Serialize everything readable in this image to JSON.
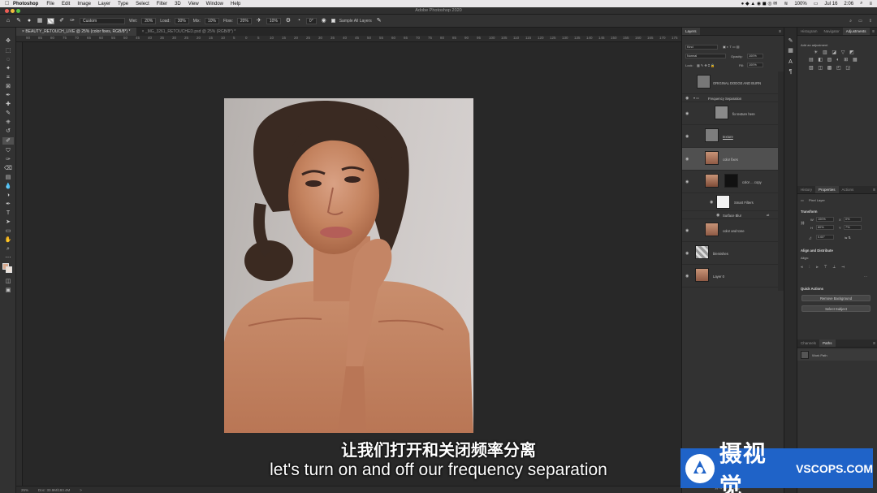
{
  "menubar": {
    "app_name": "Photoshop",
    "items": [
      "File",
      "Edit",
      "Image",
      "Layer",
      "Type",
      "Select",
      "Filter",
      "3D",
      "View",
      "Window",
      "Help"
    ],
    "battery": "100%",
    "date": "Jul 16",
    "time": "2:06"
  },
  "window": {
    "title": "Adobe Photoshop 2020"
  },
  "options": {
    "mode": "Custom",
    "size_label": "Wet:",
    "size_value": "20%",
    "load_label": "Load:",
    "load_value": "30%",
    "mix_label": "Mix:",
    "mix_value": "10%",
    "flow_label": "Flow:",
    "flow_value": "20%",
    "smoothing_value": "10%",
    "angle_value": "0°",
    "sample_all_layers": "Sample All Layers"
  },
  "document_tabs": [
    {
      "label": "BEAUTY_RETOUCH_LIVE @ 25% (color fixes, RGB/8*) *",
      "active": true
    },
    {
      "label": "_MG_3261_RETOUCHED.psd @ 25% (RGB/8*) *",
      "active": false
    }
  ],
  "ruler_ticks": [
    "90",
    "85",
    "80",
    "75",
    "70",
    "65",
    "60",
    "55",
    "50",
    "45",
    "40",
    "35",
    "30",
    "25",
    "20",
    "15",
    "10",
    "5",
    "0",
    "5",
    "10",
    "15",
    "20",
    "25",
    "30",
    "35",
    "40",
    "45",
    "50",
    "55",
    "60",
    "65",
    "70",
    "75",
    "80",
    "85",
    "90",
    "95",
    "100",
    "105",
    "110",
    "115",
    "120",
    "125",
    "130",
    "135",
    "140",
    "145",
    "150",
    "155",
    "160",
    "165",
    "170",
    "175"
  ],
  "status": {
    "zoom": "25%",
    "doc": "Doc: 33.9M/193.4M",
    "arrow": ">"
  },
  "subtitles": {
    "chinese": "让我们打开和关闭频率分离",
    "english": "let's turn on and off our frequency separation"
  },
  "layers_panel": {
    "tabs": [
      "Layers"
    ],
    "filter_kind": "Kind",
    "blend_mode": "Normal",
    "opacity_label": "Opacity:",
    "opacity_value": "100%",
    "lock_label": "Lock:",
    "fill_label": "Fill:",
    "fill_value": "100%",
    "layers": [
      {
        "name": "ORIGINAL DODGE AND BURN",
        "visible": false,
        "selected": false
      },
      {
        "name": "Frequency Separation",
        "visible": true,
        "selected": false,
        "group": true
      },
      {
        "name": "fix texture here",
        "visible": true,
        "selected": false
      },
      {
        "name": "texture",
        "visible": true,
        "selected": false
      },
      {
        "name": "color fixes",
        "visible": true,
        "selected": true
      },
      {
        "name": "color ... copy",
        "visible": true,
        "selected": false
      },
      {
        "name": "Smart Filters",
        "visible": true,
        "selected": false
      },
      {
        "name": "Surface Blur",
        "visible": true,
        "selected": false
      },
      {
        "name": "color and tone",
        "visible": true,
        "selected": false
      },
      {
        "name": "blemishes",
        "visible": true,
        "selected": false
      },
      {
        "name": "Layer 0",
        "visible": true,
        "selected": false
      }
    ]
  },
  "right_top_panel": {
    "tabs": [
      "Histogram",
      "Navigator",
      "Adjustments"
    ],
    "active": "Adjustments",
    "add_adjustment": "Add an adjustment"
  },
  "properties_panel": {
    "tabs": [
      "History",
      "Properties",
      "Actions"
    ],
    "active": "Properties",
    "kind": "Pixel Layer",
    "transform_label": "Transform",
    "w_label": "W",
    "w_value": "100%",
    "x_label": "X",
    "x_value": "0%",
    "h_label": "H",
    "h_value": "80%",
    "y_label": "Y",
    "y_value": "7%",
    "angle_value": "0.00°",
    "align_label": "Align and Distribute",
    "align_sub": "Align:",
    "quick_actions_label": "Quick Actions",
    "remove_background": "Remove Background",
    "select_subject": "Select Subject"
  },
  "paths_panel": {
    "tabs": [
      "Channels",
      "Paths"
    ],
    "active": "Paths",
    "items": [
      "Work Path"
    ]
  },
  "watermark": {
    "chinese": "摄视觉",
    "english": "VSCOPS.COM"
  },
  "colors": {
    "accent": "#1f63c8",
    "foreground_swatch": "#d7a98e",
    "background_swatch": "#ede2da"
  }
}
